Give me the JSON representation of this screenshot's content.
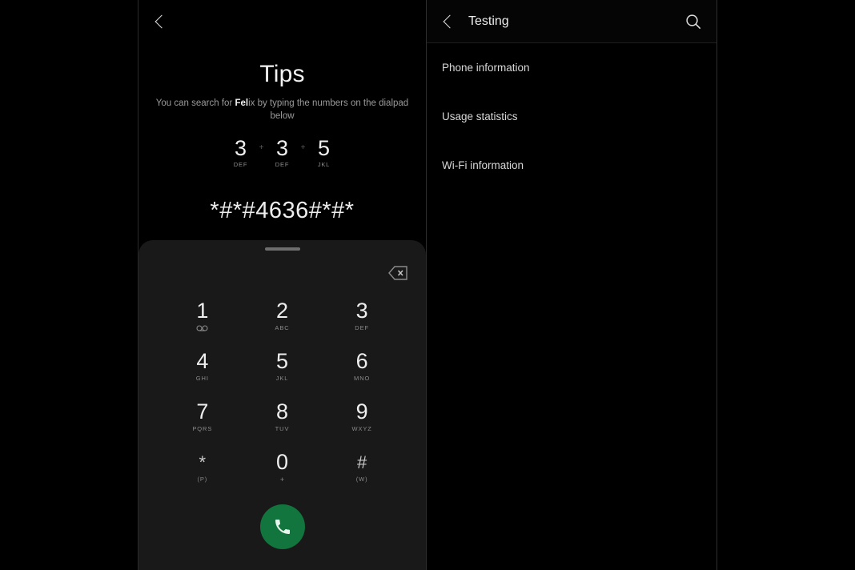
{
  "left_panel": {
    "back_icon": "chevron-left-icon",
    "title": "Tips",
    "subtitle_before": "You can search for ",
    "subtitle_highlight_bold": "Fel",
    "subtitle_highlight_rest": "ix",
    "subtitle_after": " by typing the numbers on the dialpad below",
    "digit_hints": [
      {
        "num": "3",
        "letters": "DEF"
      },
      {
        "num": "3",
        "letters": "DEF"
      },
      {
        "num": "5",
        "letters": "JKL"
      }
    ],
    "hint_separator": "+",
    "code_string": "*#*#4636#*#*",
    "dialpad": {
      "drag_handle": "drag-handle",
      "backspace_icon": "backspace-icon",
      "keys": [
        {
          "num": "1",
          "sub": "∞",
          "name": "key-1"
        },
        {
          "num": "2",
          "sub": "ABC",
          "name": "key-2"
        },
        {
          "num": "3",
          "sub": "DEF",
          "name": "key-3"
        },
        {
          "num": "4",
          "sub": "GHI",
          "name": "key-4"
        },
        {
          "num": "5",
          "sub": "JKL",
          "name": "key-5"
        },
        {
          "num": "6",
          "sub": "MNO",
          "name": "key-6"
        },
        {
          "num": "7",
          "sub": "PQRS",
          "name": "key-7"
        },
        {
          "num": "8",
          "sub": "TUV",
          "name": "key-8"
        },
        {
          "num": "9",
          "sub": "WXYZ",
          "name": "key-9"
        },
        {
          "num": "*",
          "sub": "(P)",
          "name": "key-star"
        },
        {
          "num": "0",
          "sub": "+",
          "name": "key-0"
        },
        {
          "num": "#",
          "sub": "(W)",
          "name": "key-hash"
        }
      ],
      "call_button_icon": "phone-icon",
      "call_button_color": "#11753d"
    }
  },
  "right_panel": {
    "back_icon": "chevron-left-icon",
    "title": "Testing",
    "search_icon": "search-icon",
    "items": [
      {
        "label": "Phone information"
      },
      {
        "label": "Usage statistics"
      },
      {
        "label": "Wi-Fi information"
      }
    ]
  },
  "colors": {
    "background": "#000000",
    "sheet": "#191919",
    "accent_green": "#11753d",
    "text_primary": "#ececec",
    "text_secondary": "#8a8a8a"
  }
}
